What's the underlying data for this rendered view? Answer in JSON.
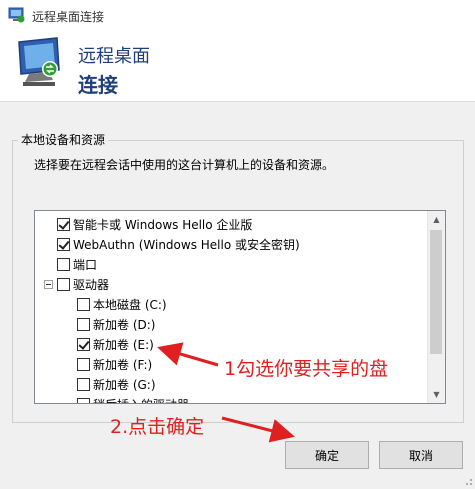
{
  "window": {
    "title": "远程桌面连接"
  },
  "banner": {
    "line1": "远程桌面",
    "line2": "连接"
  },
  "group": {
    "title": "本地设备和资源",
    "description": "选择要在远程会话中使用的这台计算机上的设备和资源。"
  },
  "devices": [
    {
      "label": "智能卡或 Windows Hello 企业版",
      "checked": true
    },
    {
      "label": "WebAuthn (Windows Hello 或安全密钥)",
      "checked": true
    },
    {
      "label": "端口",
      "checked": false
    },
    {
      "label": "驱动器",
      "checked": false,
      "expanded": true
    },
    {
      "label": "本地磁盘 (C:)",
      "checked": false
    },
    {
      "label": "新加卷 (D:)",
      "checked": false
    },
    {
      "label": "新加卷 (E:)",
      "checked": true
    },
    {
      "label": "新加卷 (F:)",
      "checked": false
    },
    {
      "label": "新加卷 (G:)",
      "checked": false
    },
    {
      "label": "稍后插入的驱动器",
      "checked": false
    }
  ],
  "buttons": {
    "ok": "确定",
    "cancel": "取消"
  },
  "annotations": {
    "step1": "1勾选你要共享的盘",
    "step2": "2.点击确定"
  },
  "colors": {
    "annotation": "#e02020",
    "banner_text": "#1f3f7a"
  }
}
